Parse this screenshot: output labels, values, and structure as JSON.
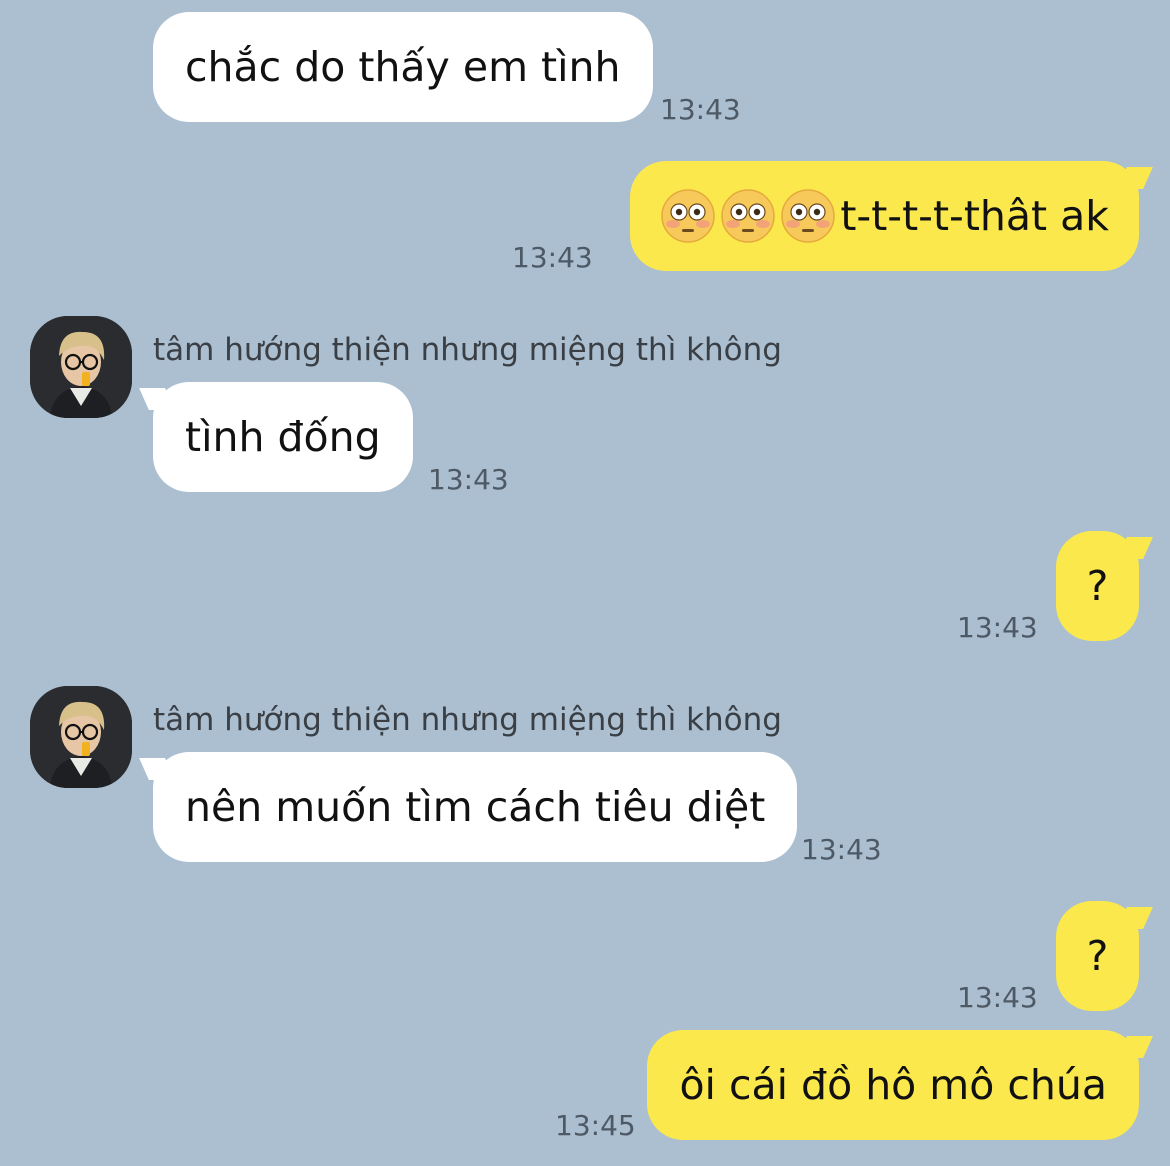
{
  "messages": [
    {
      "id": 1,
      "direction": "incoming",
      "text": "chắc do thấy em tình",
      "time": "13:43"
    },
    {
      "id": 2,
      "direction": "outgoing",
      "emoji": [
        "flushed-face",
        "flushed-face",
        "flushed-face"
      ],
      "text": "t-t-t-t-thât ak",
      "time": "13:43"
    },
    {
      "id": 3,
      "direction": "incoming",
      "sender": "tâm hướng thiện nhưng miệng thì không",
      "text": "tình đống",
      "time": "13:43"
    },
    {
      "id": 4,
      "direction": "outgoing",
      "text": "?",
      "time": "13:43"
    },
    {
      "id": 5,
      "direction": "incoming",
      "sender": "tâm hướng thiện nhưng miệng thì không",
      "text": "nên muốn tìm cách tiêu diệt",
      "time": "13:43"
    },
    {
      "id": 6,
      "direction": "outgoing",
      "text": "?",
      "time": "13:43"
    },
    {
      "id": 7,
      "direction": "outgoing",
      "text": "ôi cái đồ hô mô chúa",
      "time": "13:45"
    }
  ],
  "colors": {
    "background": "#abbfd0",
    "incoming_bubble": "#ffffff",
    "outgoing_bubble": "#fbe84d",
    "timestamp": "#4e5966"
  }
}
